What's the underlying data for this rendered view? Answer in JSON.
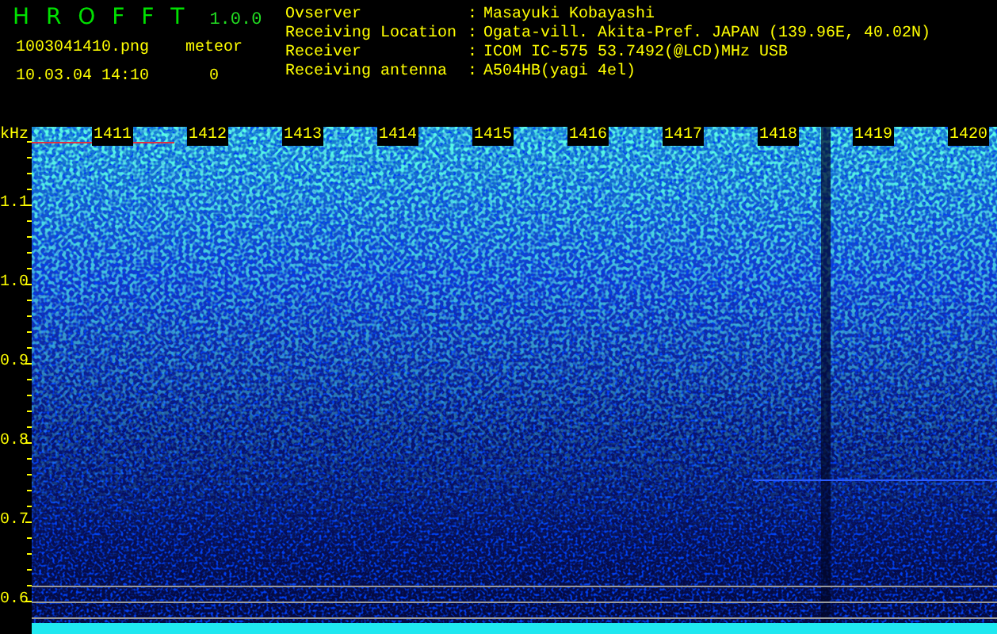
{
  "header": {
    "title": "H R O F F T",
    "version": "1.0.0",
    "file_name": "1003041410.png",
    "timestamp": "10.03.04 14:10",
    "counter_label": "meteor",
    "counter_value": "0"
  },
  "info": [
    {
      "label": "Ovserver",
      "separator": ":",
      "value": "Masayuki Kobayashi"
    },
    {
      "label": "Receiving Location",
      "separator": ":",
      "value": "Ogata-vill. Akita-Pref. JAPAN (139.96E, 40.02N)"
    },
    {
      "label": "Receiver",
      "separator": ":",
      "value": "ICOM IC-575 53.7492(@LCD)MHz USB"
    },
    {
      "label": "Receiving antenna",
      "separator": ":",
      "value": "A504HB(yagi 4el)"
    }
  ],
  "spectrogram": {
    "unit": "kHz",
    "time_labels": [
      "1411",
      "1412",
      "1413",
      "1414",
      "1415",
      "1416",
      "1417",
      "1418",
      "1419",
      "1420"
    ],
    "frequency_labels": [
      "1.1",
      "1.0",
      "0.9",
      "0.8",
      "0.7",
      "0.6"
    ]
  }
}
